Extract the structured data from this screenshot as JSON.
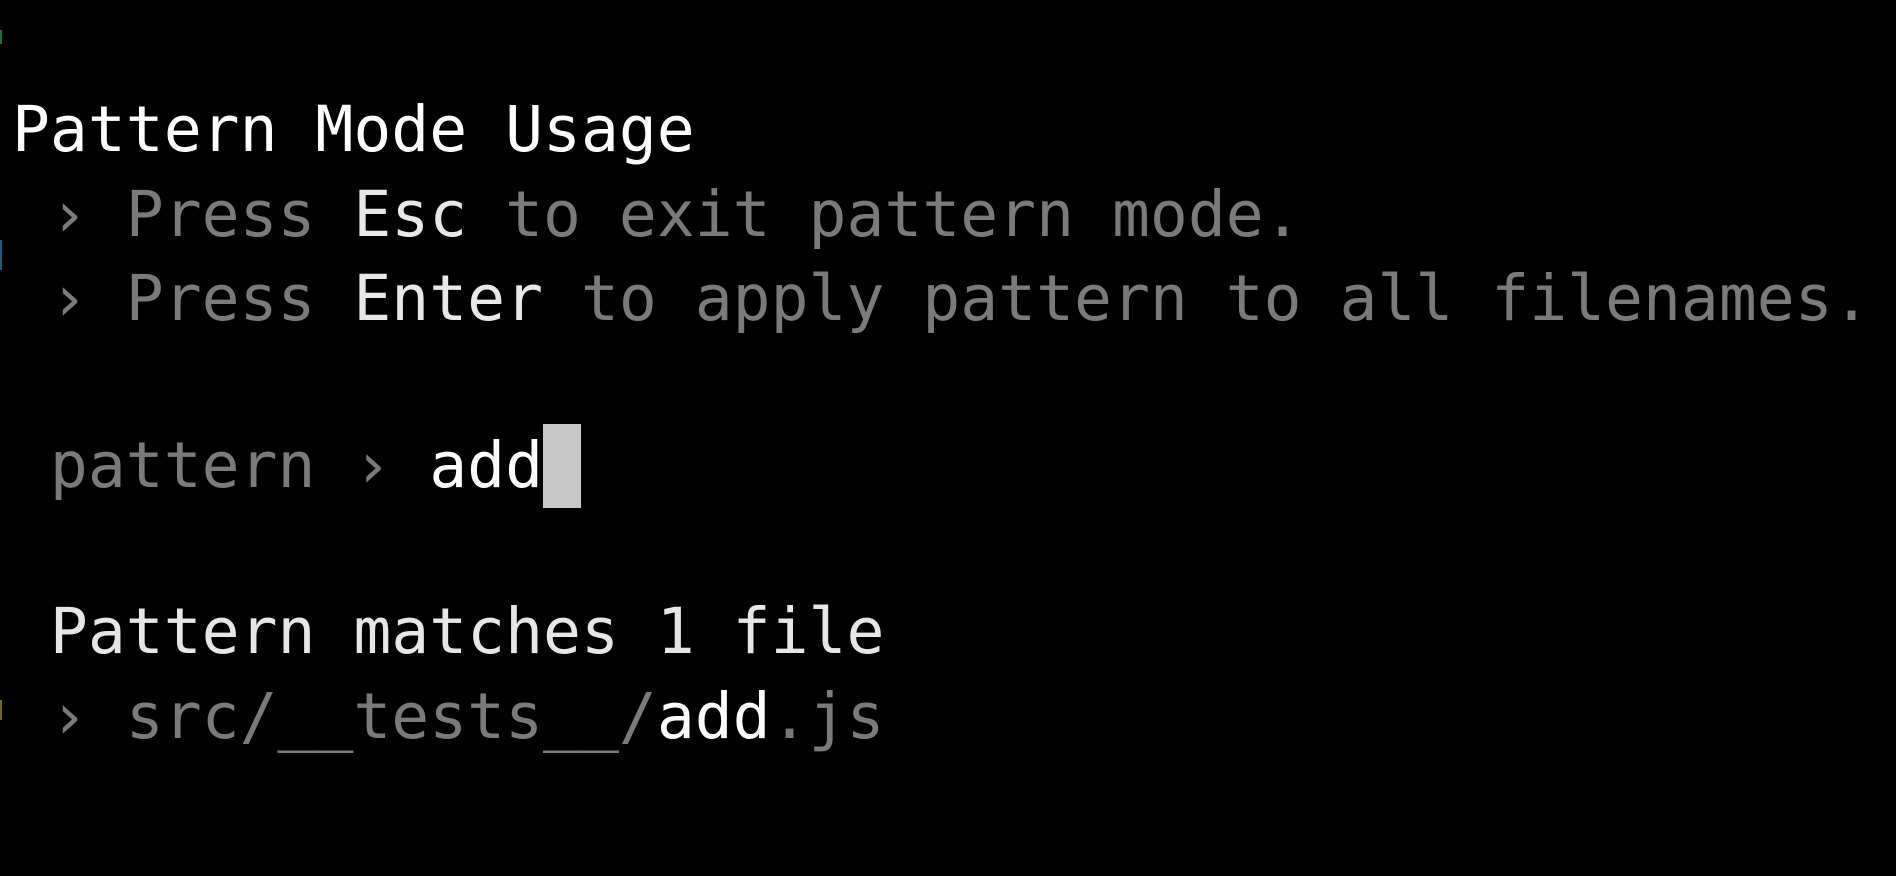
{
  "terminal": {
    "title": "Pattern Mode Usage",
    "usage_lines": [
      {
        "prefix": " › Press ",
        "key": "Esc",
        "suffix": " to exit pattern mode."
      },
      {
        "prefix": " › Press ",
        "key": "Enter",
        "suffix": " to apply pattern to all filenames."
      }
    ],
    "prompt": {
      "label": " pattern › ",
      "value": "add"
    },
    "summary": " Pattern matches 1 file",
    "matches": [
      {
        "arrow": " › ",
        "dir": "src/__tests__/",
        "highlight": "add",
        "ext": ".js"
      }
    ]
  },
  "colors": {
    "background": "#000000",
    "bright_text": "#ffffff",
    "dim_text": "#7a7a7a",
    "cursor": "#c8c8c8"
  }
}
